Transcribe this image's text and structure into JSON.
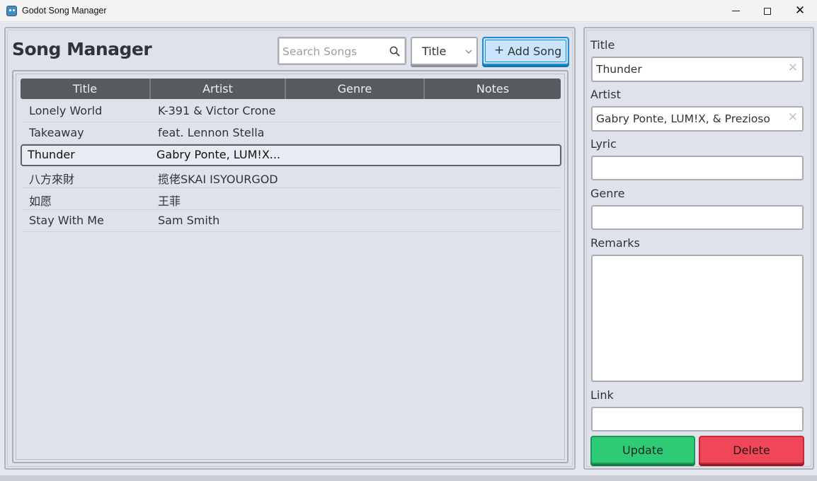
{
  "window": {
    "title": "Godot Song Manager"
  },
  "header": {
    "title": "Song Manager",
    "search_placeholder": "Search Songs",
    "search_value": "",
    "sort_selected": "Title",
    "add_label": "Add Song",
    "add_icon": "+"
  },
  "table": {
    "columns": [
      "Title",
      "Artist",
      "Genre",
      "Notes"
    ],
    "rows": [
      {
        "title": "Lonely World",
        "artist": "K-391 & Victor Crone",
        "genre": "",
        "notes": ""
      },
      {
        "title": "Takeaway",
        "artist": "feat. Lennon Stella",
        "genre": "",
        "notes": ""
      },
      {
        "title": "Thunder",
        "artist": "Gabry Ponte, LUM!X...",
        "genre": "",
        "notes": "",
        "selected": true
      },
      {
        "title": "八方來財",
        "artist": "揽佬SKAI ISYOURGOD",
        "genre": "",
        "notes": ""
      },
      {
        "title": "如愿",
        "artist": "王菲",
        "genre": "",
        "notes": ""
      },
      {
        "title": "Stay With Me",
        "artist": "Sam Smith",
        "genre": "",
        "notes": ""
      }
    ]
  },
  "form": {
    "title_label": "Title",
    "title_value": "Thunder",
    "artist_label": "Artist",
    "artist_value": "Gabry Ponte, LUM!X, & Prezioso",
    "lyric_label": "Lyric",
    "lyric_value": "",
    "genre_label": "Genre",
    "genre_value": "",
    "remarks_label": "Remarks",
    "remarks_value": "",
    "link_label": "Link",
    "link_value": "",
    "update_label": "Update",
    "delete_label": "Delete"
  },
  "colors": {
    "accent": "#1d8fd8",
    "update": "#2fca76",
    "delete": "#ef4658",
    "header_bg": "#575a5f"
  }
}
